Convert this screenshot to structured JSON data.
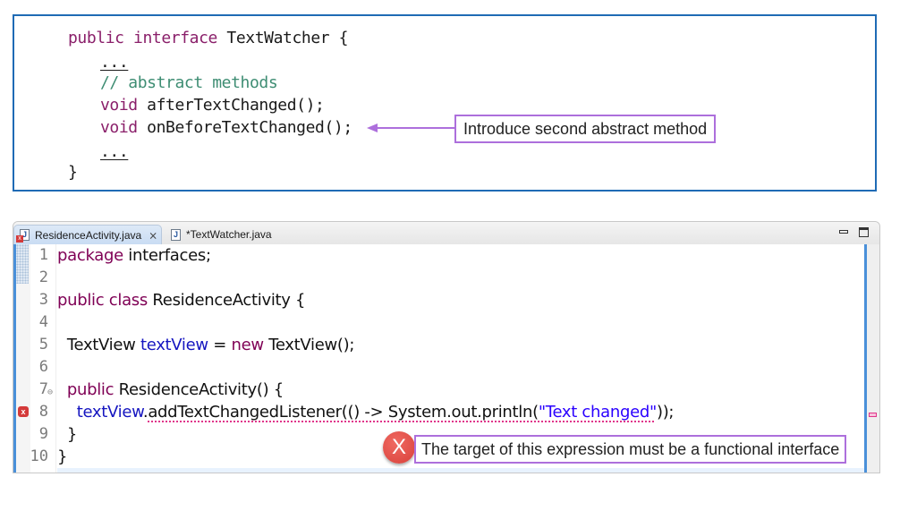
{
  "snippet": {
    "lines": [
      {
        "keyword": "public interface",
        "text": " TextWatcher {"
      },
      {
        "dots": "..."
      },
      {
        "comment": "// abstract methods"
      },
      {
        "keyword": "void",
        "text": " afterTextChanged();"
      },
      {
        "keyword": "void",
        "text": " onBeforeTextChanged();"
      },
      {
        "dots": "..."
      },
      {
        "text": "}"
      }
    ],
    "callout": "Introduce second abstract method"
  },
  "editor": {
    "tabs": [
      {
        "label": "ResidenceActivity.java",
        "active": true,
        "has_error": true,
        "close": "⨯"
      },
      {
        "label": "*TextWatcher.java",
        "active": false
      }
    ],
    "line_numbers": [
      "1",
      "2",
      "3",
      "4",
      "5",
      "6",
      "7",
      "8",
      "9",
      "10"
    ],
    "code": {
      "l1_kw": "package",
      "l1_rest": " interfaces;",
      "l3_kw": "public class",
      "l3_rest": " ResidenceActivity {",
      "l5_type": "  TextView ",
      "l5_field": "textView",
      "l5_mid": " = ",
      "l5_kw": "new",
      "l5_rest": " TextView();",
      "l7_kw": "  public",
      "l7_rest": " ResidenceActivity() {",
      "l8_indent": "    ",
      "l8_field": "textView",
      "l8_dot": ".",
      "l8_call": "addTextChangedListener(() -> System.out.println(",
      "l8_str": "\"Text changed\"",
      "l8_end": "));",
      "l9": "  }",
      "l10": "}"
    },
    "fold_marker": "⊖",
    "error_marker": "x"
  },
  "error_annotation": {
    "icon": "X",
    "message": "The target of this expression must be a functional interface"
  },
  "colors": {
    "snippet_border": "#1f6bb5",
    "callout_border": "#ad6fdc",
    "keyword": "#7f0055",
    "comment": "#3e8d73",
    "field": "#1515c0",
    "error_red": "#d8403a",
    "squiggle": "#e0358a"
  }
}
